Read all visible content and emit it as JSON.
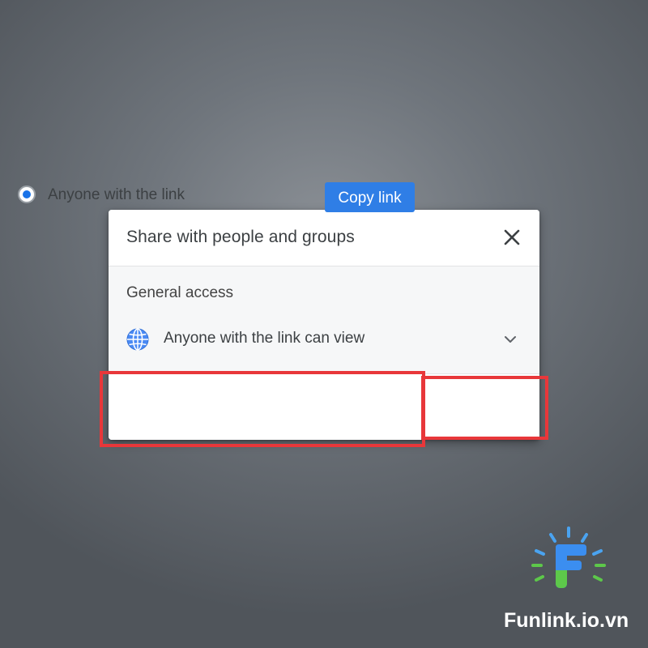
{
  "dialog": {
    "title": "Share with people and groups",
    "close_icon": "close-icon",
    "general_access": {
      "label": "General access",
      "value": "Anyone with the link can view",
      "icon": "globe-icon",
      "dropdown_icon": "chevron-down-icon"
    },
    "link_option": {
      "label": "Anyone with the link",
      "selected": true
    },
    "copy_button": "Copy link"
  },
  "colors": {
    "accent": "#1a73e8",
    "button": "#2f7ee6",
    "highlight": "#e8373a"
  },
  "watermark": {
    "text": "Funlink.io.vn"
  }
}
